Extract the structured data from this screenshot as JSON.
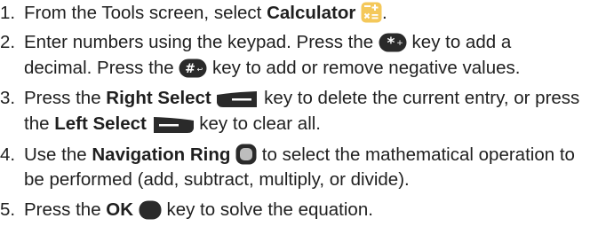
{
  "steps": [
    {
      "number": "1.",
      "t1": "From the Tools screen, select ",
      "b1": "Calculator",
      "t2": "."
    },
    {
      "number": "2.",
      "t1": "Enter numbers using the keypad. Press the ",
      "t2": " key to add a",
      "t3": "decimal. Press the ",
      "t4": " key to add or remove negative values."
    },
    {
      "number": "3.",
      "t1": "Press the ",
      "b1": "Right Select",
      "t2": " key to delete the current entry, or press",
      "t3": "the ",
      "b2": "Left Select",
      "t4": " key to clear all."
    },
    {
      "number": "4.",
      "t1": "Use the ",
      "b1": "Navigation Ring",
      "t2": " to select the mathematical operation to",
      "t3": "be performed (add, subtract, multiply, or divide)."
    },
    {
      "number": "5.",
      "t1": "Press the ",
      "b1": "OK",
      "t2": " key to solve the equation."
    }
  ],
  "icons": {
    "calculator": "calculator-app-icon",
    "star": "star-key-icon",
    "pound": "pound-key-icon",
    "right_select": "right-select-key-icon",
    "left_select": "left-select-key-icon",
    "nav_ring": "navigation-ring-icon",
    "ok": "ok-key-icon"
  },
  "colors": {
    "text": "#1f1f1f",
    "key_dark": "#2a2a2a",
    "calculator_bg": "#f4c85a"
  }
}
